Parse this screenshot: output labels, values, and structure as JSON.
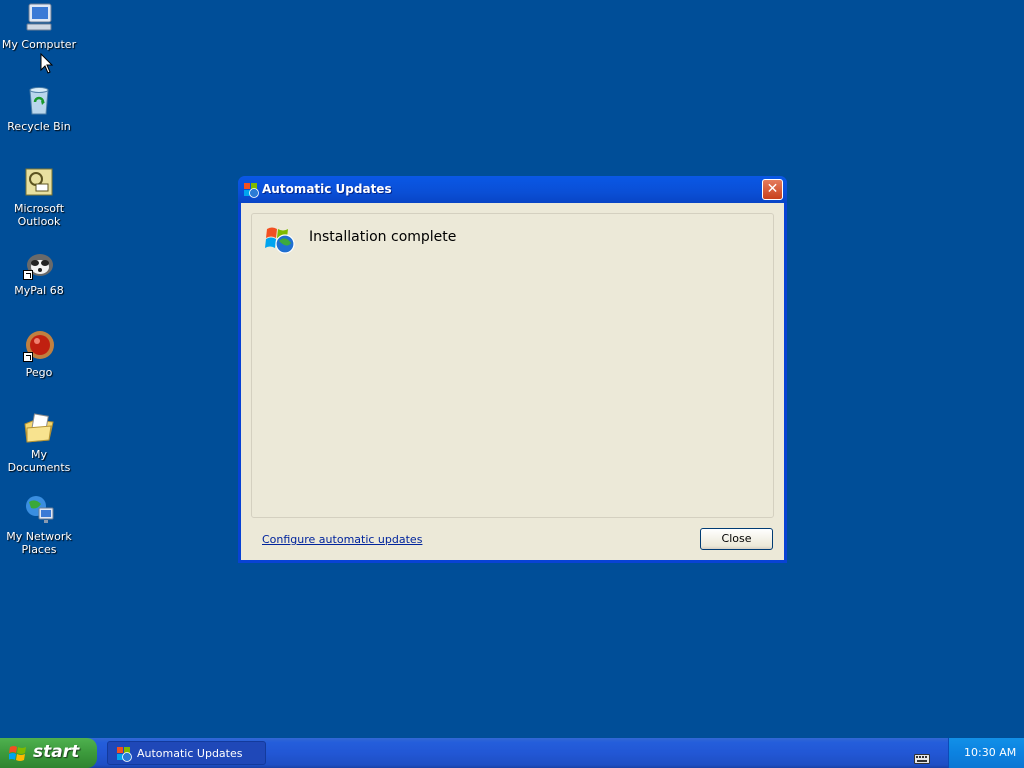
{
  "desktop": {
    "background_color": "#004e98",
    "icons": [
      {
        "label_line1": "My Computer",
        "label_line2": "",
        "icon": "my-computer-icon"
      },
      {
        "label_line1": "Recycle Bin",
        "label_line2": "",
        "icon": "recycle-bin-icon"
      },
      {
        "label_line1": "Microsoft",
        "label_line2": "Outlook",
        "icon": "outlook-icon"
      },
      {
        "label_line1": "MyPal 68",
        "label_line2": "",
        "icon": "mypal-icon"
      },
      {
        "label_line1": "Pego",
        "label_line2": "",
        "icon": "pego-icon"
      },
      {
        "label_line1": "My Documents",
        "label_line2": "",
        "icon": "my-documents-icon"
      },
      {
        "label_line1": "My Network",
        "label_line2": "Places",
        "icon": "network-places-icon"
      }
    ]
  },
  "dialog": {
    "title": "Automatic Updates",
    "status_heading": "Installation complete",
    "configure_link": "Configure automatic updates",
    "close_button": "Close",
    "close_glyph": "✕"
  },
  "taskbar": {
    "start_label": "start",
    "task_button_label": "Automatic Updates",
    "clock": "10:30 AM"
  }
}
